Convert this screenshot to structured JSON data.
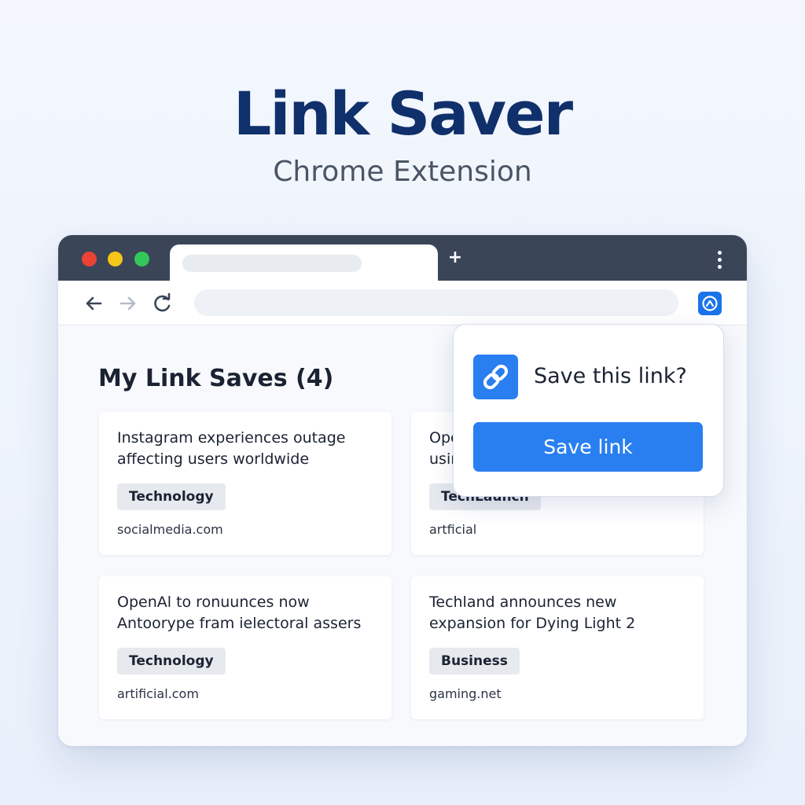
{
  "hero": {
    "title": "Link Saver",
    "subtitle": "Chrome Extension"
  },
  "browser": {
    "new_tab_symbol": "+",
    "icons": {
      "back": "arrow-left-icon",
      "forward": "arrow-right-icon",
      "reload": "reload-icon",
      "extension": "link-saver-extension-icon",
      "menu": "kebab-menu-icon"
    }
  },
  "page": {
    "heading": "My Link Saves (4)",
    "cards": [
      {
        "title": "Instagram experiences outage affecting users worldwide",
        "tag": "Technology",
        "domain": "socialmedia.com"
      },
      {
        "title": "Ope",
        "title_line2": "usir",
        "tag": "TechLaunch",
        "domain": "artficial"
      },
      {
        "title": "OpenAl to ronuunces now Antoorype fram ielectoral assers",
        "tag": "Technology",
        "domain": "artificial.com"
      },
      {
        "title": "Techland announces new expansion for Dying Light 2",
        "tag": "Business",
        "domain": "gaming.net"
      }
    ]
  },
  "popup": {
    "question": "Save this link?",
    "button_label": "Save link",
    "icon": "link-icon"
  },
  "colors": {
    "accent": "#2a7ff0",
    "title_blue": "#10306b",
    "titlebar": "#3a4558"
  }
}
